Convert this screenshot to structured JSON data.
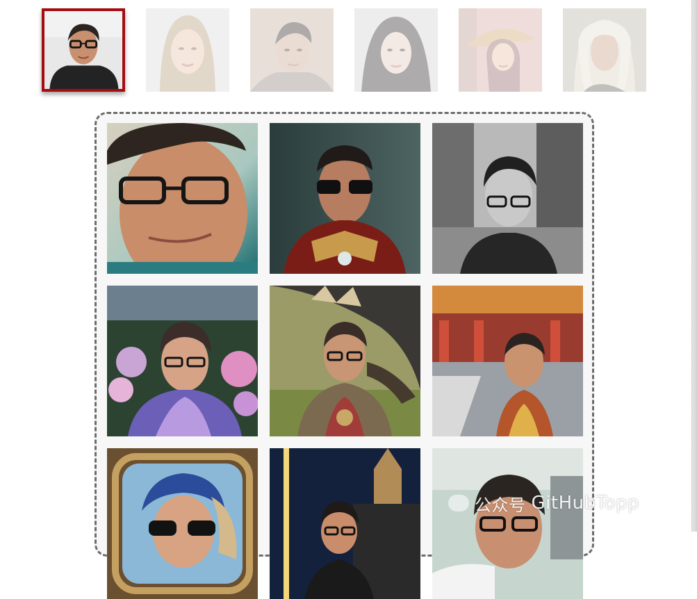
{
  "reference_faces": [
    {
      "name": "reference-1",
      "selected": true
    },
    {
      "name": "reference-2",
      "selected": false
    },
    {
      "name": "reference-3",
      "selected": false
    },
    {
      "name": "reference-4",
      "selected": false
    },
    {
      "name": "reference-5",
      "selected": false
    },
    {
      "name": "reference-6",
      "selected": false
    }
  ],
  "colors": {
    "selected_border": "#a30d12",
    "gallery_border": "#6c6c6c"
  },
  "gallery": {
    "images": [
      "closeup-portrait",
      "armor-suit-portrait",
      "street-black-and-white-portrait",
      "flower-garden-portrait",
      "dragon-warrior-portrait",
      "palace-courtyard-portrait",
      "pearl-earring-style-portrait",
      "night-castle-portrait",
      "street-closeup-portrait"
    ]
  },
  "watermark": {
    "icon": "wechat-icon",
    "cjk": "公众号",
    "text": "GitHubTopp"
  }
}
